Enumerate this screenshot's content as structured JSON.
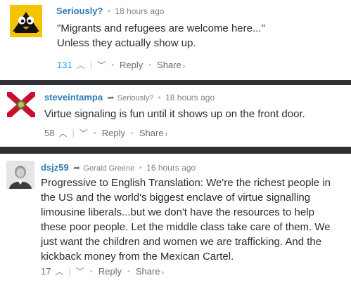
{
  "comments": [
    {
      "author": "Seriously?",
      "time": "18 hours ago",
      "body": [
        "\"Migrants and refugees are welcome here...\"",
        "Unless they actually show up."
      ],
      "votes": "131",
      "reply_label": "Reply",
      "share_label": "Share",
      "avatar_icon": "penguin-icon"
    },
    {
      "author": "steveintampa",
      "reply_to": "Seriously?",
      "time": "18 hours ago",
      "body": [
        "Virtue signaling is fun until it shows up on the front door."
      ],
      "votes": "58",
      "reply_label": "Reply",
      "share_label": "Share",
      "avatar_icon": "florida-flag-icon"
    },
    {
      "author": "dsjz59",
      "reply_to": "Gerald Greene",
      "time": "16 hours ago",
      "body": [
        "Progressive to English Translation: We're the richest people in",
        "the US and the world's biggest enclave of virtue signalling",
        "limousine liberals...but we don't have the resources to help",
        "these poor people. Let the middle class take care of them. We",
        "just want the children and women we are trafficking. And the",
        "kickback money from the Mexican Cartel."
      ],
      "votes": "17",
      "reply_label": "Reply",
      "share_label": "Share",
      "avatar_icon": "portrait-avatar-icon"
    }
  ],
  "colors": {
    "author": "#2e7bb6",
    "accent_vote": "#2e9fff",
    "background": "#2f3033"
  }
}
